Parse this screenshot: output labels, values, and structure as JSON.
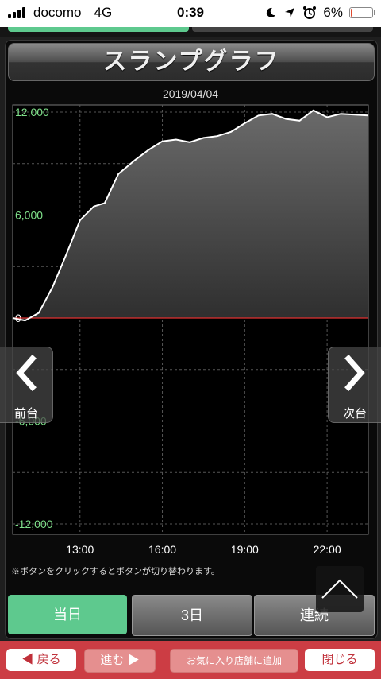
{
  "status": {
    "carrier": "docomo",
    "network": "4G",
    "time": "0:39",
    "battery": "6%",
    "battery_level": 0.06,
    "icons": [
      "moon-icon",
      "location-arrow-icon",
      "alarm-icon"
    ]
  },
  "title": "スランプグラフ",
  "chart_data": {
    "type": "area",
    "date": "2019/04/04",
    "y_ticks": [
      "12,000",
      "6,000",
      "0",
      "-6,000",
      "-12,000"
    ],
    "y_tick_values": [
      12000,
      6000,
      0,
      -6000,
      -12000
    ],
    "x_ticks": [
      "13:00",
      "16:00",
      "19:00",
      "22:00"
    ],
    "x_tick_values": [
      13,
      16,
      19,
      22
    ],
    "ylim": [
      -12000,
      12000
    ],
    "xlim": [
      10.55,
      23.5
    ],
    "grid": true,
    "colors": {
      "line": "#ffffff",
      "zero_line": "#e03030",
      "tick_label": "#7fe08a",
      "fill_top": "#6a6a6a",
      "fill_bottom": "#2e2e2e"
    },
    "series": [
      {
        "points": [
          [
            10.55,
            0
          ],
          [
            11.0,
            -150
          ],
          [
            11.5,
            300
          ],
          [
            12.0,
            1800
          ],
          [
            12.5,
            3700
          ],
          [
            13.0,
            5700
          ],
          [
            13.5,
            6500
          ],
          [
            13.9,
            6700
          ],
          [
            14.4,
            8400
          ],
          [
            15.0,
            9200
          ],
          [
            15.5,
            9800
          ],
          [
            16.0,
            10300
          ],
          [
            16.5,
            10400
          ],
          [
            17.0,
            10250
          ],
          [
            17.5,
            10500
          ],
          [
            18.0,
            10600
          ],
          [
            18.5,
            10850
          ],
          [
            19.0,
            11350
          ],
          [
            19.5,
            11800
          ],
          [
            20.0,
            11900
          ],
          [
            20.5,
            11600
          ],
          [
            21.0,
            11500
          ],
          [
            21.5,
            12100
          ],
          [
            22.0,
            11700
          ],
          [
            22.5,
            11900
          ],
          [
            23.0,
            11850
          ],
          [
            23.5,
            11800
          ]
        ]
      }
    ]
  },
  "nav": {
    "prev_label": "前台",
    "next_label": "次台"
  },
  "note": "※ボタンをクリックするとボタンが切り替わります。",
  "tabs": [
    "当日",
    "3日",
    "連続"
  ],
  "bottom": {
    "back": "◀ 戻る",
    "forward": "進む ▶",
    "favorite": "お気に入り店舗に追加",
    "close": "閉じる"
  }
}
